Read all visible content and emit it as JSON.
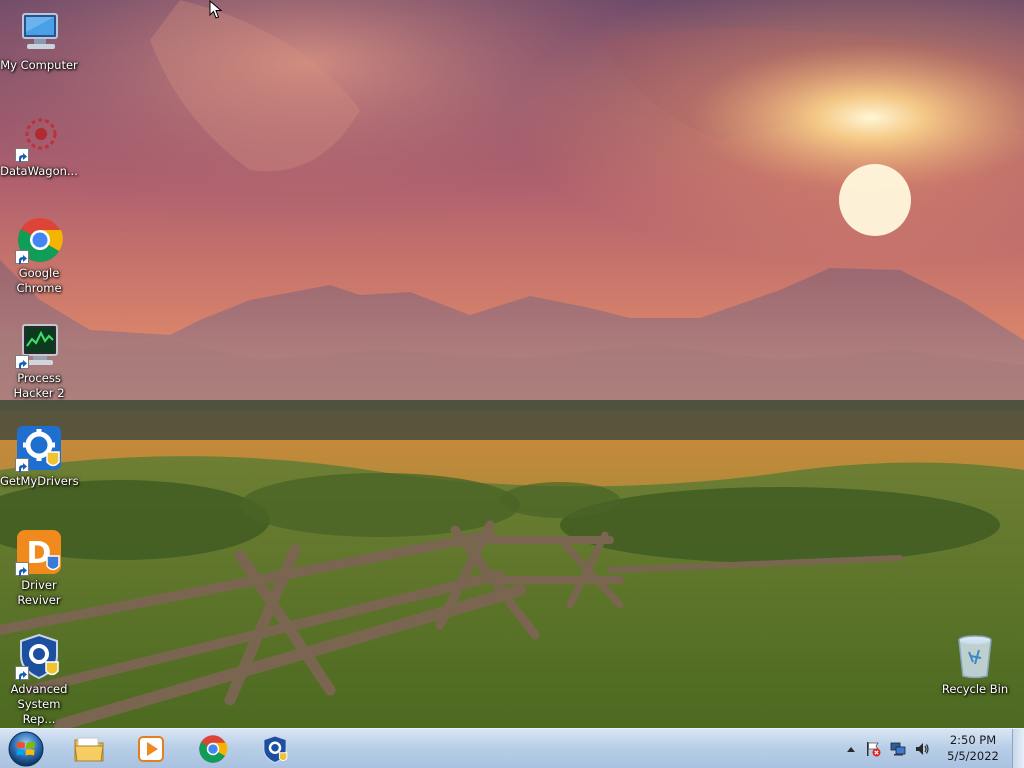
{
  "desktop": {
    "icons": [
      {
        "label": "My Computer",
        "icon": "computer-icon"
      },
      {
        "label": "DataWagon...",
        "icon": "datawagon-icon"
      },
      {
        "label": "Google Chrome",
        "icon": "chrome-icon"
      },
      {
        "label": "Process Hacker 2",
        "icon": "process-hacker-icon"
      },
      {
        "label": "GetMyDrivers",
        "icon": "getmydrivers-icon"
      },
      {
        "label": "Driver Reviver",
        "icon": "driver-reviver-icon"
      },
      {
        "label": "Advanced System Rep...",
        "icon": "advanced-system-repair-icon"
      },
      {
        "label": "Recycle Bin",
        "icon": "recycle-bin-icon"
      }
    ],
    "wallpaper": "sunset-mountains-meadow-fence"
  },
  "taskbar": {
    "start_button": "windows-start-orb-icon",
    "pinned": [
      {
        "name": "File Explorer",
        "icon": "folder-icon"
      },
      {
        "name": "Windows Media Player",
        "icon": "media-player-icon"
      },
      {
        "name": "Google Chrome",
        "icon": "chrome-icon"
      },
      {
        "name": "Advanced System Repair",
        "icon": "shield-gear-icon"
      }
    ],
    "tray": {
      "icons": [
        "show-hidden-icons-arrow-icon",
        "action-center-flag-icon",
        "network-icon",
        "volume-icon"
      ],
      "time": "2:50 PM",
      "date": "5/5/2022"
    }
  },
  "colors": {
    "taskbar_top": "#d9e6f4",
    "taskbar_bottom": "#a9c2e0",
    "sky_orange": "#f0a060",
    "sun": "#fff6d0"
  }
}
